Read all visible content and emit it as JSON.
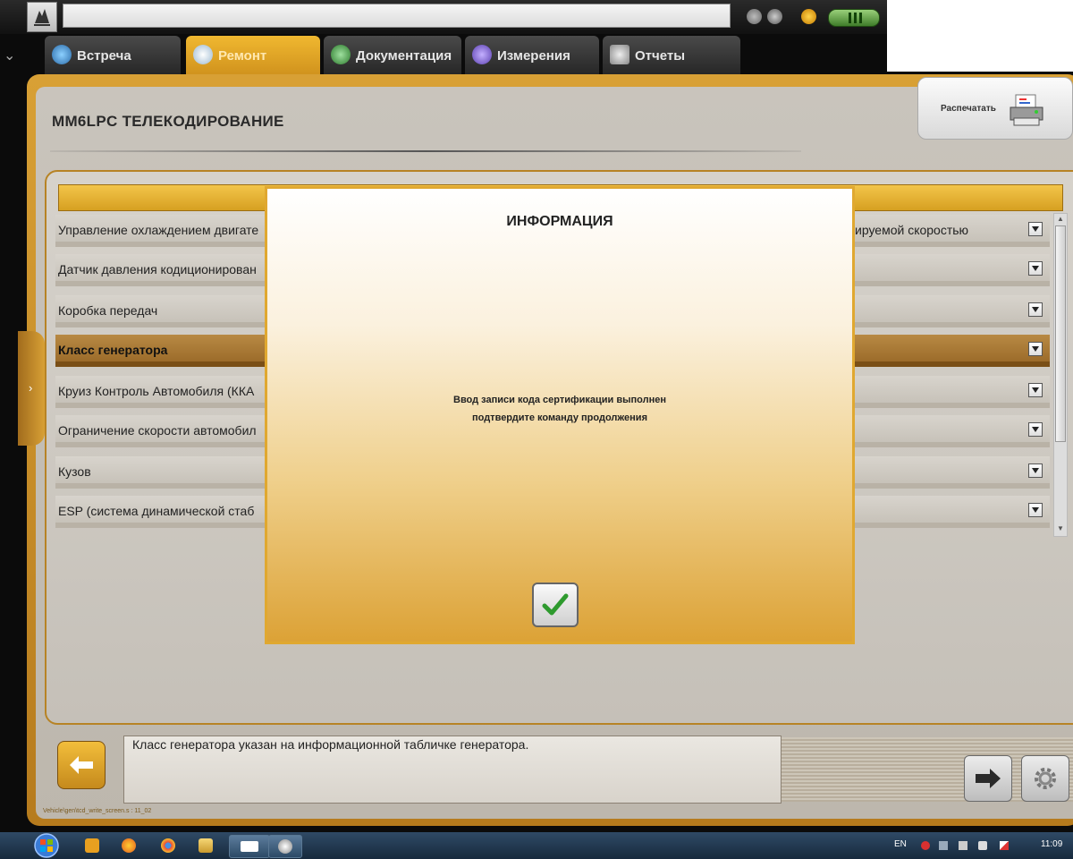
{
  "app": {
    "tabs": [
      {
        "label": "Встреча",
        "active": false
      },
      {
        "label": "Ремонт",
        "active": true
      },
      {
        "label": "Документация",
        "active": false
      },
      {
        "label": "Измерения",
        "active": false
      },
      {
        "label": "Отчеты",
        "active": false
      }
    ],
    "print_label": "Распечатать"
  },
  "page": {
    "title": "MM6LPC  ТЕЛЕКОДИРОВАНИЕ",
    "rows": [
      {
        "label": "Управление охлаждением двигате",
        "value": "ируемой скоростью",
        "selected": false
      },
      {
        "label": "Датчик давления кодиционирован",
        "value": "",
        "selected": false
      },
      {
        "label": "Коробка передач",
        "value": "",
        "selected": false
      },
      {
        "label": "Класс генератора",
        "value": "",
        "selected": true
      },
      {
        "label": "Круиз Контроль Автомобиля (ККА",
        "value": "",
        "selected": false
      },
      {
        "label": "Ограничение скорости автомобил",
        "value": "",
        "selected": false
      },
      {
        "label": "Кузов",
        "value": "",
        "selected": false
      },
      {
        "label": "ESP (система динамической стаб",
        "value": "",
        "selected": false
      }
    ],
    "help_text": "Класс генератора указан на информационной табличке генератора.",
    "path": "Vehicle\\gen\\tcd_write_screen.s : 11_02"
  },
  "modal": {
    "title": "ИНФОРМАЦИЯ",
    "message_line1": "Ввод записи кода сертификации выполнен",
    "message_line2": "подтвердите команду продолжения",
    "ok_icon": "checkmark-icon"
  },
  "taskbar": {
    "language": "EN",
    "clock": "11:09"
  },
  "colors": {
    "accent": "#d8a035",
    "tab_active": "#f0b830",
    "selected_row": "#a87534",
    "modal_border": "#e0a830"
  }
}
